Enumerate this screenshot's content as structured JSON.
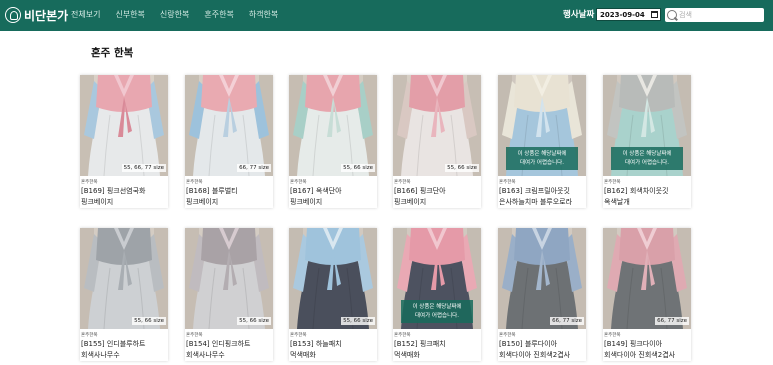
{
  "header": {
    "logo_text": "비단본가",
    "nav": [
      "전체보기",
      "신부한복",
      "신랑한복",
      "혼주한복",
      "하객한복"
    ],
    "date_label": "행사날짜",
    "date_value": "2023-09-04",
    "search_placeholder": "검색"
  },
  "page_title": "혼주 한복",
  "colors": {
    "brand": "#176b5c",
    "white": "#ffffff"
  },
  "products": [
    {
      "cat": "혼주한복",
      "name1": "[B169] 핑크선염국화",
      "name2": "핑크베이지",
      "size": "55, 66, 77 size",
      "overlay": "",
      "jacket": "#e8a7b0",
      "collar": "#f1c7cf",
      "sleeve": "#a9c8de",
      "skirt": "#e7e9ea",
      "band": "#d98a98",
      "bg": "#d9d0c6"
    },
    {
      "cat": "혼주한복",
      "name1": "[B168] 블루벌티",
      "name2": "핑크베이지",
      "size": "66, 77 size",
      "overlay": "",
      "jacket": "#e9aab1",
      "collar": "#f4d0d6",
      "sleeve": "#9dc2dc",
      "skirt": "#e4e8ea",
      "band": "#b9cfe0",
      "bg": "#d6cec4"
    },
    {
      "cat": "혼주한복",
      "name1": "[B167] 옥색단아",
      "name2": "핑크베이지",
      "size": "55, 66 size",
      "overlay": "",
      "jacket": "#e7a5ad",
      "collar": "#f1cfd4",
      "sleeve": "#a8cfc7",
      "skirt": "#e6ebe9",
      "band": "#c7ddd6",
      "bg": "#d4ccc2"
    },
    {
      "cat": "혼주한복",
      "name1": "[B166] 핑크단아",
      "name2": "핑크베이지",
      "size": "55, 66 size",
      "overlay": "",
      "jacket": "#e39ea8",
      "collar": "#f0c8cf",
      "sleeve": "#d9c8c2",
      "skirt": "#e9e4e2",
      "band": "#e9b5bd",
      "bg": "#d7cfc5"
    },
    {
      "cat": "혼주한복",
      "name1": "[B163] 크림프릴아웃깃",
      "name2": "은사하늘치마 블루오로라",
      "size": "",
      "overlay": "이 상품은 해당날짜에\n대여가 어렵습니다.",
      "jacket": "#e8e2d3",
      "collar": "#f2eee2",
      "sleeve": "#e9e5d8",
      "skirt": "#a5c6dc",
      "band": "#d2e3ee",
      "bg": "#cfc7bf"
    },
    {
      "cat": "혼주한복",
      "name1": "[B162] 회색차이웃깃",
      "name2": "옥색날개",
      "size": "",
      "overlay": "이 상품은 해당날짜에\n대여가 어렵습니다.",
      "jacket": "#b8bbb9",
      "collar": "#e8e7e2",
      "sleeve": "#c2c4c1",
      "skirt": "#a9d2cc",
      "band": "#d3e7e3",
      "bg": "#d1c9c0"
    },
    {
      "cat": "혼주한복",
      "name1": "[B155] 인디블루하트",
      "name2": "회색사나무수",
      "size": "55, 66 size",
      "overlay": "",
      "jacket": "#9ea3a8",
      "collar": "#c9ccd0",
      "sleeve": "#b9bdc1",
      "skirt": "#cdd0d3",
      "band": "#a9aeb3",
      "bg": "#d4ccc3"
    },
    {
      "cat": "혼주한복",
      "name1": "[B154] 인디핑크하트",
      "name2": "회색사나무수",
      "size": "55, 66 size",
      "overlay": "",
      "jacket": "#a9a2a6",
      "collar": "#d7cbd0",
      "sleeve": "#c0bbbf",
      "skirt": "#d0d0d2",
      "band": "#b3adb1",
      "bg": "#d4ccc3"
    },
    {
      "cat": "혼주한복",
      "name1": "[B153] 하늘패치",
      "name2": "먹색매화",
      "size": "55, 66 size",
      "overlay": "",
      "jacket": "#9fc3dc",
      "collar": "#d9e7f0",
      "sleeve": "#aac9df",
      "skirt": "#4a4f5c",
      "band": "#9fc3dc",
      "bg": "#d1c9c0"
    },
    {
      "cat": "혼주한복",
      "name1": "[B152] 핑크패치",
      "name2": "먹색매화",
      "size": "",
      "overlay": "이 상품은 해당날짜에\n대여가 어렵습니다.",
      "jacket": "#e59aa8",
      "collar": "#f1c7cf",
      "sleeve": "#e9a9b4",
      "skirt": "#4d5260",
      "band": "#e59aa8",
      "bg": "#d1c9c0"
    },
    {
      "cat": "혼주한복",
      "name1": "[B150] 블루다이아",
      "name2": "회색다이아 진회색2겹사",
      "size": "66, 77 size",
      "overlay": "",
      "jacket": "#8fa6c2",
      "collar": "#c8d4e2",
      "sleeve": "#9aafc8",
      "skirt": "#6d7174",
      "band": "#a4b7cd",
      "bg": "#d2cac1"
    },
    {
      "cat": "혼주한복",
      "name1": "[B149] 핑크다이아",
      "name2": "회색다이아 진회색2겹사",
      "size": "66, 77 size",
      "overlay": "",
      "jacket": "#d9a0a9",
      "collar": "#efcdd3",
      "sleeve": "#dfaab2",
      "skirt": "#6f7376",
      "band": "#e0b0b8",
      "bg": "#d2cac1"
    }
  ]
}
